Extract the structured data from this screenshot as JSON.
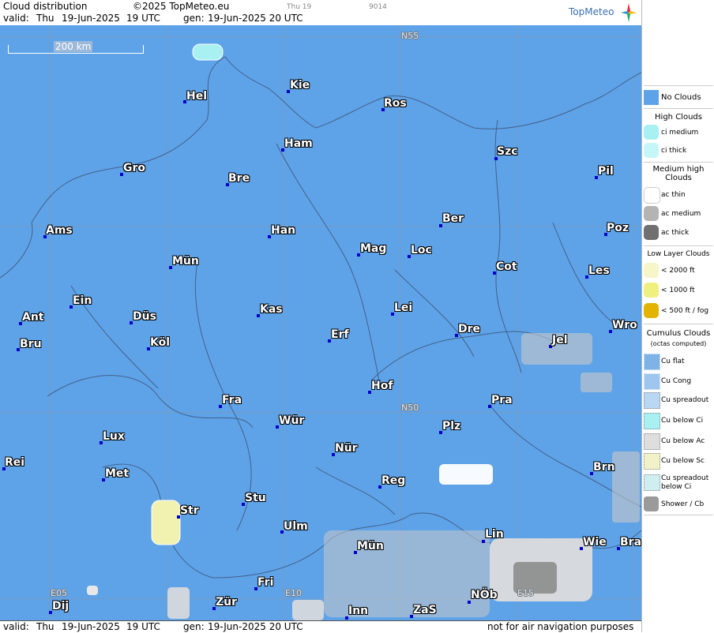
{
  "header": {
    "title": "Cloud distribution",
    "copyright": "©2025 TopMeteo.eu",
    "valid_label": "valid:",
    "valid_day": "Thu",
    "valid_date": "19-Jun-2025",
    "valid_time": "19 UTC",
    "gen_label": "gen:",
    "gen_datetime": "19-Jun-2025 20 UTC",
    "small_day": "Thu 19",
    "small_code": "9014",
    "logo": "TopMeteo"
  },
  "footer": {
    "valid_label": "valid:",
    "valid_day": "Thu",
    "valid_date": "19-Jun-2025",
    "valid_time": "19 UTC",
    "gen_label": "gen:",
    "gen_datetime": "19-Jun-2025 20 UTC",
    "disclaimer": "not for air navigation purposes"
  },
  "map": {
    "scale_label": "200 km",
    "grid_labels": [
      "N55",
      "N50",
      "E05",
      "E10",
      "E15"
    ],
    "colors": {
      "no_clouds": "#5ea3e8",
      "grid": "#8a95a8",
      "city_dot": "#0000cc",
      "low_cloud": "#f2f2b0",
      "cumulus": "#c8c8c8"
    },
    "cities": [
      {
        "name": "Hel"
      },
      {
        "name": "Kie"
      },
      {
        "name": "Ros"
      },
      {
        "name": "Ham"
      },
      {
        "name": "Szc"
      },
      {
        "name": "Gro"
      },
      {
        "name": "Bre"
      },
      {
        "name": "Pil"
      },
      {
        "name": "Ber"
      },
      {
        "name": "Ams"
      },
      {
        "name": "Han"
      },
      {
        "name": "Poz"
      },
      {
        "name": "Mag"
      },
      {
        "name": "Loc"
      },
      {
        "name": "Mün"
      },
      {
        "name": "Cot"
      },
      {
        "name": "Les"
      },
      {
        "name": "Ein"
      },
      {
        "name": "Kas"
      },
      {
        "name": "Lei"
      },
      {
        "name": "Ant"
      },
      {
        "name": "Düs"
      },
      {
        "name": "Wro"
      },
      {
        "name": "Erf"
      },
      {
        "name": "Dre"
      },
      {
        "name": "Bru"
      },
      {
        "name": "Köl"
      },
      {
        "name": "Jel"
      },
      {
        "name": "Hof"
      },
      {
        "name": "Fra"
      },
      {
        "name": "Pra"
      },
      {
        "name": "Wür"
      },
      {
        "name": "Lux"
      },
      {
        "name": "Plz"
      },
      {
        "name": "Nür"
      },
      {
        "name": "Rei"
      },
      {
        "name": "Met"
      },
      {
        "name": "Brn"
      },
      {
        "name": "Reg"
      },
      {
        "name": "Stu"
      },
      {
        "name": "Str"
      },
      {
        "name": "Lin"
      },
      {
        "name": "Ulm"
      },
      {
        "name": "Mün"
      },
      {
        "name": "Wie"
      },
      {
        "name": "Bra"
      },
      {
        "name": "Fri"
      },
      {
        "name": "NÖb"
      },
      {
        "name": "Dij"
      },
      {
        "name": "Zür"
      },
      {
        "name": "Inn"
      },
      {
        "name": "ZaS"
      }
    ]
  },
  "legend": {
    "no_clouds": "No Clouds",
    "high_clouds": "High Clouds",
    "ci_medium": "ci medium",
    "ci_thick": "ci thick",
    "medium_high": "Medium high Clouds",
    "ac_thin": "ac thin",
    "ac_medium": "ac medium",
    "ac_thick": "ac thick",
    "low_layer": "Low Layer Clouds",
    "lt2000": "< 2000 ft",
    "lt1000": "< 1000 ft",
    "lt500": "< 500 ft / fog",
    "cumulus": "Cumulus Clouds",
    "cumulus_sub": "(octas computed)",
    "cu_flat": "Cu flat",
    "cu_cong": "Cu Cong",
    "cu_spreadout": "Cu spreadout",
    "cu_below_ci": "Cu below Ci",
    "cu_below_ac": "Cu below Ac",
    "cu_below_sc": "Cu below Sc",
    "cu_spreadout_below_ci": "Cu spreadout below Ci",
    "shower_cb": "Shower / Cb"
  }
}
